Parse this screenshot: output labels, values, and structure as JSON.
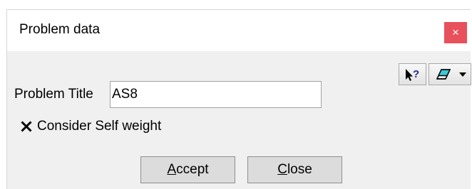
{
  "window": {
    "title": "Problem data",
    "close_glyph": "×"
  },
  "toolbar": {
    "help_icon": "context-help-icon",
    "eraser_icon": "eraser-icon",
    "dropdown_icon": "chevron-down-icon"
  },
  "form": {
    "problem_title_label": "Problem Title",
    "problem_title_value": "AS8",
    "consider_self_weight_label": "Consider Self weight",
    "consider_self_weight_checked": true
  },
  "buttons": {
    "accept_first": "A",
    "accept_rest": "ccept",
    "close_first": "C",
    "close_rest": "lose"
  },
  "colors": {
    "close_button_bg": "#e8505b",
    "dialog_bg": "#f0f0f0",
    "titlebar_bg": "#ffffff"
  }
}
